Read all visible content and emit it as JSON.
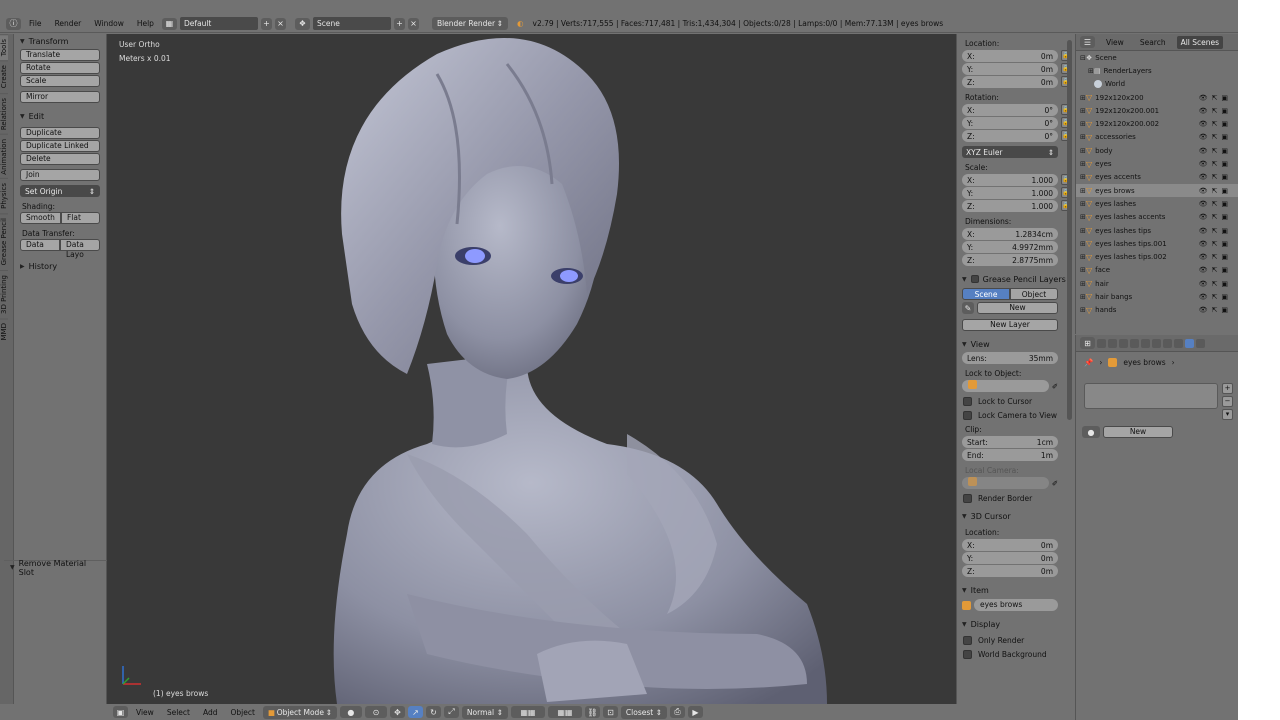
{
  "topbar": {
    "menus": [
      "File",
      "Render",
      "Window",
      "Help"
    ],
    "layout": "Default",
    "scene": "Scene",
    "engine": "Blender Render",
    "stats": "v2.79 | Verts:717,555 | Faces:717,481 | Tris:1,434,304 | Objects:0/28 | Lamps:0/0 | Mem:77.13M | eyes brows"
  },
  "tabs": [
    "Tools",
    "Create",
    "Relations",
    "Animation",
    "Physics",
    "Grease Pencil",
    "3D Printing",
    "MMD"
  ],
  "toolshelf": {
    "transform_title": "Transform",
    "transform": [
      "Translate",
      "Rotate",
      "Scale"
    ],
    "mirror": "Mirror",
    "edit_title": "Edit",
    "edit": [
      "Duplicate",
      "Duplicate Linked",
      "Delete"
    ],
    "join": "Join",
    "set_origin": "Set Origin",
    "shading_label": "Shading:",
    "shading": [
      "Smooth",
      "Flat"
    ],
    "data_transfer_label": "Data Transfer:",
    "data_transfer": [
      "Data",
      "Data Layo"
    ],
    "history_title": "History",
    "last_op": "Remove Material Slot"
  },
  "viewport": {
    "view_name": "User Ortho",
    "units": "Meters x 0.01",
    "selection": "(1) eyes brows"
  },
  "bottombar": {
    "menus": [
      "View",
      "Select",
      "Add",
      "Object"
    ],
    "mode": "Object Mode",
    "orientation": "Normal",
    "snap": "Closest"
  },
  "npanel": {
    "location_label": "Location:",
    "location": [
      {
        "a": "X:",
        "v": "0m"
      },
      {
        "a": "Y:",
        "v": "0m"
      },
      {
        "a": "Z:",
        "v": "0m"
      }
    ],
    "rotation_label": "Rotation:",
    "rotation": [
      {
        "a": "X:",
        "v": "0°"
      },
      {
        "a": "Y:",
        "v": "0°"
      },
      {
        "a": "Z:",
        "v": "0°"
      }
    ],
    "rotation_mode": "XYZ Euler",
    "scale_label": "Scale:",
    "scale": [
      {
        "a": "X:",
        "v": "1.000"
      },
      {
        "a": "Y:",
        "v": "1.000"
      },
      {
        "a": "Z:",
        "v": "1.000"
      }
    ],
    "dimensions_label": "Dimensions:",
    "dimensions": [
      {
        "a": "X:",
        "v": "1.2834cm"
      },
      {
        "a": "Y:",
        "v": "4.9972mm"
      },
      {
        "a": "Z:",
        "v": "2.8775mm"
      }
    ],
    "gp_title": "Grease Pencil Layers",
    "gp_scene": "Scene",
    "gp_object": "Object",
    "gp_new": "New",
    "gp_new_layer": "New Layer",
    "view_title": "View",
    "lens_label": "Lens:",
    "lens_value": "35mm",
    "lock_obj_label": "Lock to Object:",
    "lock_cursor": "Lock to Cursor",
    "lock_camera": "Lock Camera to View",
    "clip_label": "Clip:",
    "clip_start_label": "Start:",
    "clip_start": "1cm",
    "clip_end_label": "End:",
    "clip_end": "1m",
    "local_camera": "Local Camera:",
    "render_border": "Render Border",
    "cursor_title": "3D Cursor",
    "cursor_location": [
      {
        "a": "X:",
        "v": "0m"
      },
      {
        "a": "Y:",
        "v": "0m"
      },
      {
        "a": "Z:",
        "v": "0m"
      }
    ],
    "item_title": "Item",
    "item_name": "eyes brows",
    "display_title": "Display",
    "only_render": "Only Render",
    "world_bg": "World Background"
  },
  "outliner": {
    "view": "View",
    "search": "Search",
    "scope": "All Scenes",
    "scene": "Scene",
    "render_layers": "RenderLayers",
    "world": "World",
    "items": [
      "192x120x200",
      "192x120x200.001",
      "192x120x200.002",
      "accessories",
      "body",
      "eyes",
      "eyes accents",
      "eyes brows",
      "eyes lashes",
      "eyes lashes accents",
      "eyes lashes tips",
      "eyes lashes tips.001",
      "eyes lashes tips.002",
      "face",
      "hair",
      "hair bangs",
      "hands"
    ],
    "selected": "eyes brows"
  },
  "props": {
    "context": "eyes brows",
    "new": "New"
  },
  "colors": {
    "panel": "#727272",
    "viewport": "#393939",
    "accent": "#5680c2",
    "mesh": "#e39a38"
  }
}
